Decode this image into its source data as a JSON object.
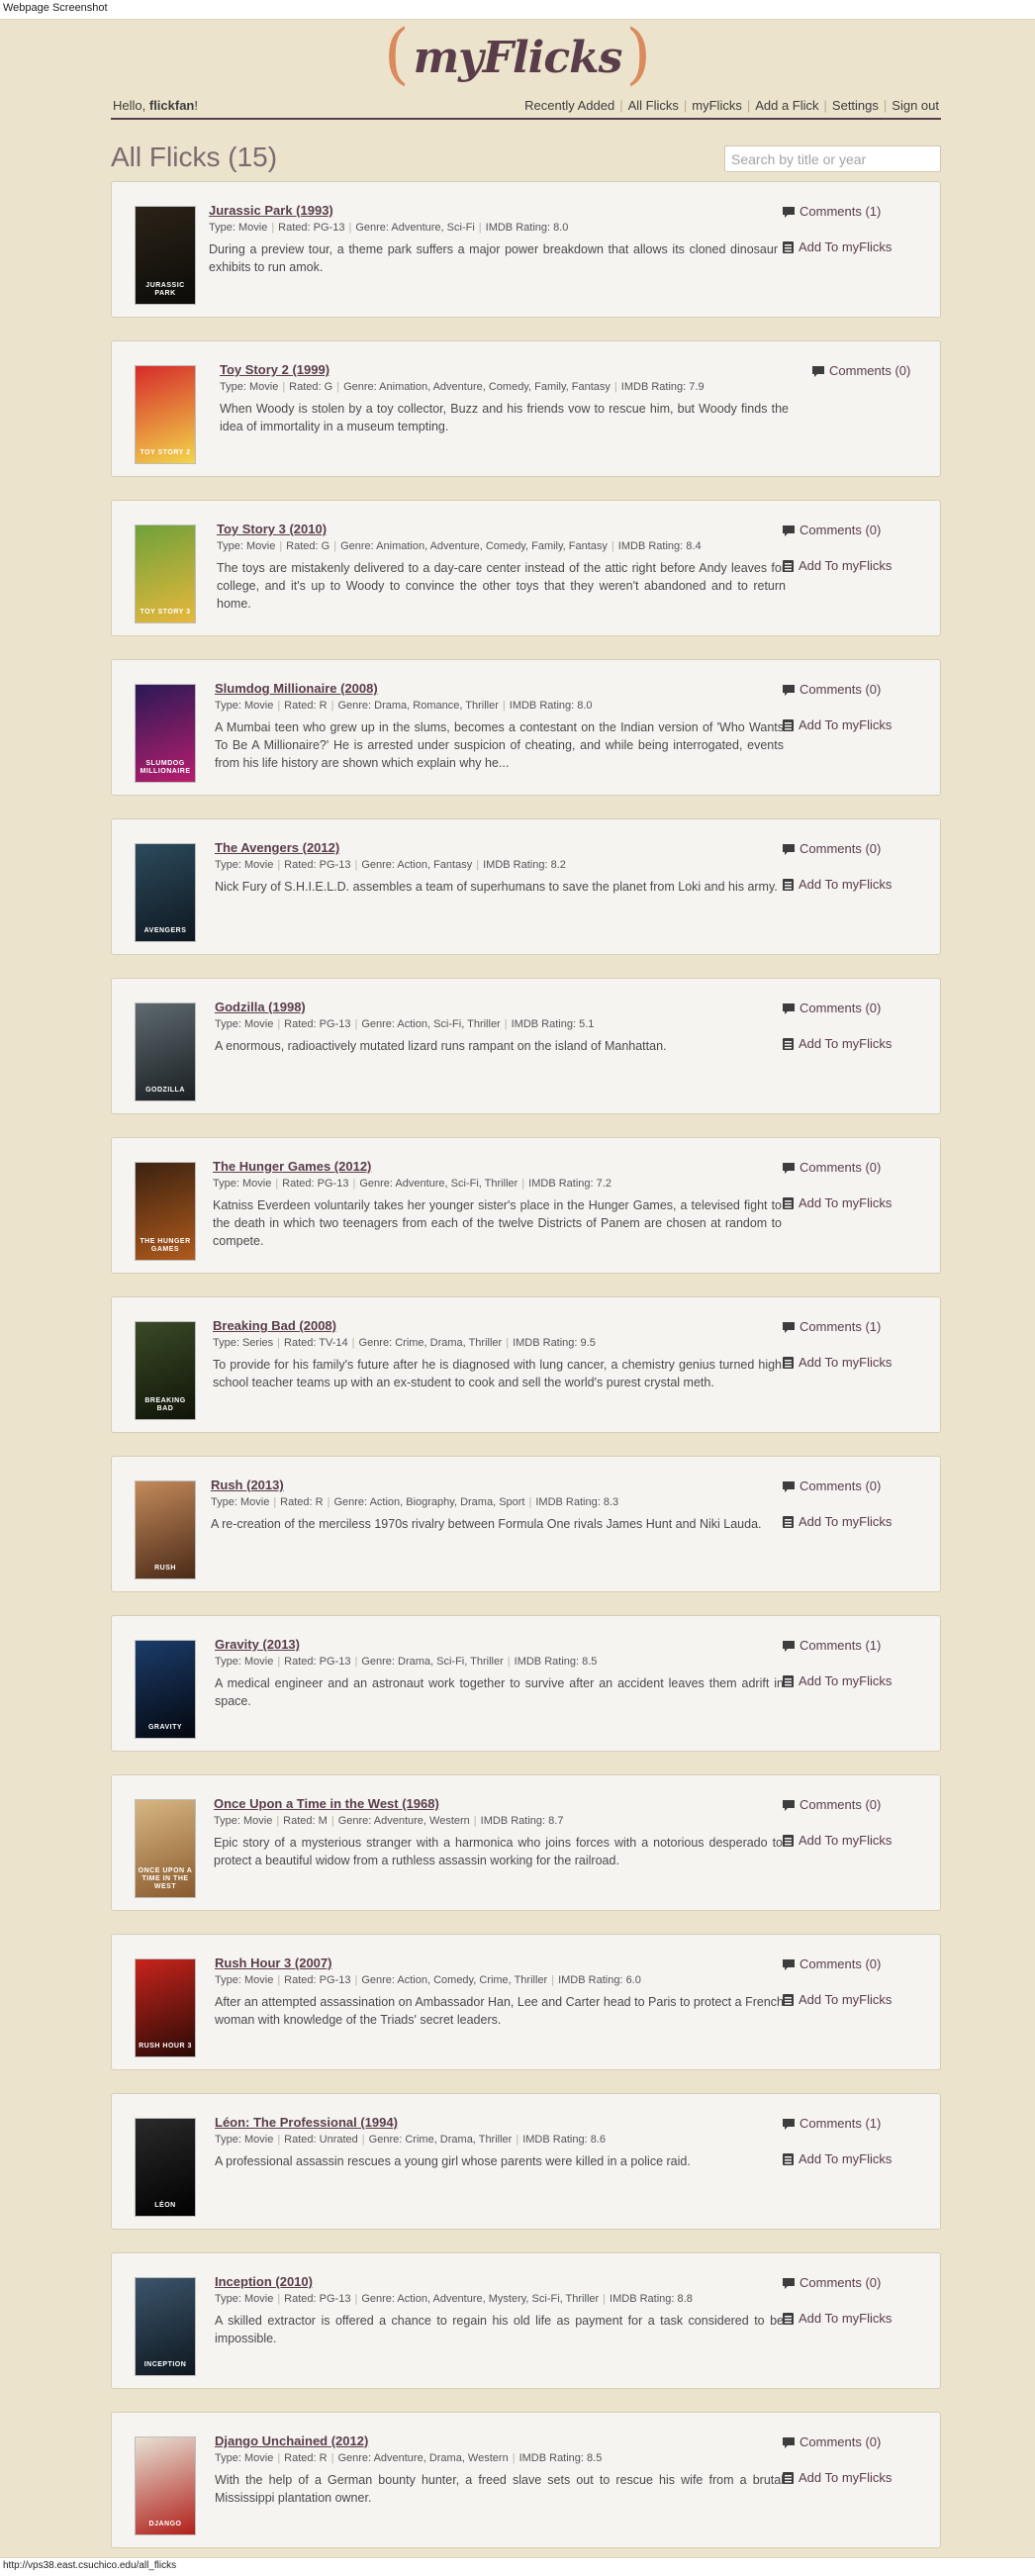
{
  "browser": {
    "frame_title": "Webpage Screenshot",
    "status_url": "http://vps38.east.csuchico.edu/all_flicks"
  },
  "logo": {
    "left_paren": "(",
    "text": "myFlicks",
    "right_paren": ")"
  },
  "header": {
    "greeting": "Hello, ",
    "username": "flickfan",
    "greeting_end": "!",
    "nav": [
      "Recently Added",
      "All Flicks",
      "myFlicks",
      "Add a Flick",
      "Settings",
      "Sign out"
    ]
  },
  "page": {
    "title": "All Flicks (15)",
    "search_placeholder": "Search by title or year"
  },
  "labels": {
    "type": "Type:",
    "rated": "Rated:",
    "genre": "Genre:",
    "imdb": "IMDB Rating:",
    "add": "Add To myFlicks"
  },
  "colors": {
    "background": "#ebe3cc",
    "card": "#f5f4f1",
    "accent": "#d98b5d",
    "brand": "#5a3d4a"
  },
  "flicks": [
    {
      "title": "Jurassic Park (1993)",
      "type": "Movie",
      "rated": "PG-13",
      "genre": "Adventure, Sci-Fi",
      "imdb": "8.0",
      "description": "During a preview tour, a theme park suffers a major power breakdown that allows its cloned dinosaur exhibits to run amok.",
      "comments": "Comments (1)",
      "add": true,
      "poster_colors": [
        "#2b2318",
        "#0c0b08"
      ],
      "poster_text": "JURASSIC PARK"
    },
    {
      "title": "Toy Story 2 (1999)",
      "type": "Movie",
      "rated": "G",
      "genre": "Animation, Adventure, Comedy, Family, Fantasy",
      "imdb": "7.9",
      "description": "When Woody is stolen by a toy collector, Buzz and his friends vow to rescue him, but Woody finds the idea of immortality in a museum tempting.",
      "comments": "Comments (0)",
      "add": false,
      "poster_colors": [
        "#d62b2b",
        "#f3d54a"
      ],
      "poster_text": "TOY STORY 2"
    },
    {
      "title": "Toy Story 3 (2010)",
      "type": "Movie",
      "rated": "G",
      "genre": "Animation, Adventure, Comedy, Family, Fantasy",
      "imdb": "8.4",
      "description": "The toys are mistakenly delivered to a day-care center instead of the attic right before Andy leaves for college, and it's up to Woody to convince the other toys that they weren't abandoned and to return home.",
      "comments": "Comments (0)",
      "add": true,
      "poster_colors": [
        "#6fa13a",
        "#e8b83c"
      ],
      "poster_text": "TOY STORY 3"
    },
    {
      "title": "Slumdog Millionaire (2008)",
      "type": "Movie",
      "rated": "R",
      "genre": "Drama, Romance, Thriller",
      "imdb": "8.0",
      "description": "A Mumbai teen who grew up in the slums, becomes a contestant on the Indian version of 'Who Wants To Be A Millionaire?' He is arrested under suspicion of cheating, and while being interrogated, events from his life history are shown which explain why he...",
      "comments": "Comments (0)",
      "add": true,
      "poster_colors": [
        "#2a1a55",
        "#b81d6e"
      ],
      "poster_text": "SLUMDOG MILLIONAIRE"
    },
    {
      "title": "The Avengers (2012)",
      "type": "Movie",
      "rated": "PG-13",
      "genre": "Action, Fantasy",
      "imdb": "8.2",
      "description": "Nick Fury of S.H.I.E.L.D. assembles a team of superhumans to save the planet from Loki and his army.",
      "comments": "Comments (0)",
      "add": true,
      "poster_colors": [
        "#2c4a5c",
        "#0e1820"
      ],
      "poster_text": "AVENGERS"
    },
    {
      "title": "Godzilla (1998)",
      "type": "Movie",
      "rated": "PG-13",
      "genre": "Action, Sci-Fi, Thriller",
      "imdb": "5.1",
      "description": "A enormous, radioactively mutated lizard runs rampant on the island of Manhattan.",
      "comments": "Comments (0)",
      "add": true,
      "poster_colors": [
        "#5e6a70",
        "#1a1f22"
      ],
      "poster_text": "GODZILLA"
    },
    {
      "title": "The Hunger Games (2012)",
      "type": "Movie",
      "rated": "PG-13",
      "genre": "Adventure, Sci-Fi, Thriller",
      "imdb": "7.2",
      "description": "Katniss Everdeen voluntarily takes her younger sister's place in the Hunger Games, a televised fight to the death in which two teenagers from each of the twelve Districts of Panem are chosen at random to compete.",
      "comments": "Comments (0)",
      "add": true,
      "poster_colors": [
        "#3b2210",
        "#b05a1c"
      ],
      "poster_text": "THE HUNGER GAMES"
    },
    {
      "title": "Breaking Bad (2008)",
      "type": "Series",
      "rated": "TV-14",
      "genre": "Crime, Drama, Thriller",
      "imdb": "9.5",
      "description": "To provide for his family's future after he is diagnosed with lung cancer, a chemistry genius turned high school teacher teams up with an ex-student to cook and sell the world's purest crystal meth.",
      "comments": "Comments (1)",
      "add": true,
      "poster_colors": [
        "#3a4a26",
        "#101408"
      ],
      "poster_text": "BREAKING BAD"
    },
    {
      "title": "Rush (2013)",
      "type": "Movie",
      "rated": "R",
      "genre": "Action, Biography, Drama, Sport",
      "imdb": "8.3",
      "description": "A re-creation of the merciless 1970s rivalry between Formula One rivals James Hunt and Niki Lauda.",
      "comments": "Comments (0)",
      "add": true,
      "poster_colors": [
        "#c48a5a",
        "#4a2a18"
      ],
      "poster_text": "RUSH"
    },
    {
      "title": "Gravity (2013)",
      "type": "Movie",
      "rated": "PG-13",
      "genre": "Drama, Sci-Fi, Thriller",
      "imdb": "8.5",
      "description": "A medical engineer and an astronaut work together to survive after an accident leaves them adrift in space.",
      "comments": "Comments (1)",
      "add": true,
      "poster_colors": [
        "#1b3c6a",
        "#04070e"
      ],
      "poster_text": "GRAVITY"
    },
    {
      "title": "Once Upon a Time in the West (1968)",
      "type": "Movie",
      "rated": "M",
      "genre": "Adventure, Western",
      "imdb": "8.7",
      "description": "Epic story of a mysterious stranger with a harmonica who joins forces with a notorious desperado to protect a beautiful widow from a ruthless assassin working for the railroad.",
      "comments": "Comments (0)",
      "add": true,
      "poster_colors": [
        "#d7b783",
        "#8a5a2c"
      ],
      "poster_text": "ONCE UPON A TIME IN THE WEST"
    },
    {
      "title": "Rush Hour 3 (2007)",
      "type": "Movie",
      "rated": "PG-13",
      "genre": "Action, Comedy, Crime, Thriller",
      "imdb": "6.0",
      "description": "After an attempted assassination on Ambassador Han, Lee and Carter head to Paris to protect a French woman with knowledge of the Triads' secret leaders.",
      "comments": "Comments (0)",
      "add": true,
      "poster_colors": [
        "#c8241c",
        "#2a0a06"
      ],
      "poster_text": "RUSH HOUR 3"
    },
    {
      "title": "Léon: The Professional (1994)",
      "type": "Movie",
      "rated": "Unrated",
      "genre": "Crime, Drama, Thriller",
      "imdb": "8.6",
      "description": "A professional assassin rescues a young girl whose parents were killed in a police raid.",
      "comments": "Comments (1)",
      "add": true,
      "poster_colors": [
        "#2a2a2a",
        "#000000"
      ],
      "poster_text": "LÉON"
    },
    {
      "title": "Inception (2010)",
      "type": "Movie",
      "rated": "PG-13",
      "genre": "Action, Adventure, Mystery, Sci-Fi, Thriller",
      "imdb": "8.8",
      "description": "A skilled extractor is offered a chance to regain his old life as payment for a task considered to be impossible.",
      "comments": "Comments (0)",
      "add": true,
      "poster_colors": [
        "#3b556b",
        "#0e171f"
      ],
      "poster_text": "INCEPTION"
    },
    {
      "title": "Django Unchained (2012)",
      "type": "Movie",
      "rated": "R",
      "genre": "Adventure, Drama, Western",
      "imdb": "8.5",
      "description": "With the help of a German bounty hunter, a freed slave sets out to rescue his wife from a brutal Mississippi plantation owner.",
      "comments": "Comments (0)",
      "add": true,
      "poster_colors": [
        "#e7e1d4",
        "#b0201a"
      ],
      "poster_text": "DJANGO"
    }
  ]
}
